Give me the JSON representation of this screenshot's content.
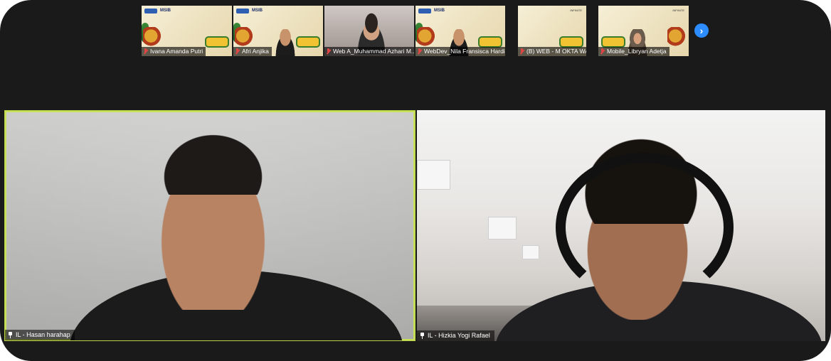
{
  "thumbnails": [
    {
      "name": "Ivana Amanda Putri",
      "muted": true,
      "kind": "background"
    },
    {
      "name": "Afri Anjika",
      "muted": true,
      "kind": "background-person"
    },
    {
      "name": "Web A_Muhammad Azhari M...",
      "muted": true,
      "kind": "video"
    },
    {
      "name": "WebDev_Nila Fransisca Hardi...",
      "muted": true,
      "kind": "background-person"
    },
    {
      "name": "(B) WEB - M OKTA WANDI",
      "muted": true,
      "kind": "background"
    },
    {
      "name": "Mobile_Libryan Adetja",
      "muted": true,
      "kind": "background-hijab"
    }
  ],
  "thumb_logo_text": "MSIB",
  "next_page_icon": "chevron-right-icon",
  "speakers": [
    {
      "name": "IL - Hasan harahap",
      "active": true
    },
    {
      "name": "IL - Hizkia Yogi Rafael",
      "active": false
    }
  ],
  "colors": {
    "window_bg": "#1a1a1a",
    "active_speaker_border": "#c9e05a",
    "accent": "#2d8cff",
    "muted_mic": "#e04545"
  }
}
